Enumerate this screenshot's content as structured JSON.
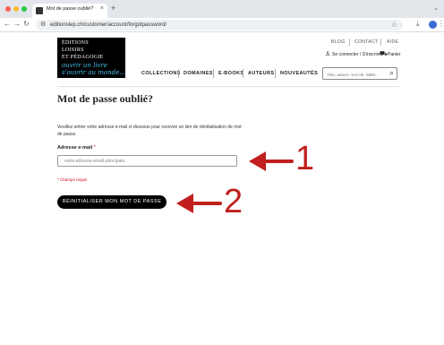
{
  "browser": {
    "tab_title": "Mot de passe oublié?",
    "url": "editionslep.ch/customer/account/forgotpassword/",
    "icons": [
      "back-icon",
      "forward-icon",
      "reload-icon",
      "site-info-icon",
      "star-icon",
      "download-icon",
      "profile-icon",
      "menu-icon"
    ]
  },
  "brand": {
    "lines": [
      "ÉDITIONS",
      "LOISIRS",
      "ET PÉDAGOGIE"
    ],
    "slogan": [
      "ouvrir un livre",
      "s'ouvrir au monde..."
    ],
    "colors": {
      "logo_bg": "#000000",
      "slogan": "#48b8e6"
    }
  },
  "topnav": {
    "blog": "BLOG",
    "contact": "CONTACT",
    "aide": "AIDE"
  },
  "account": {
    "login": "Se connecter / S'inscrire",
    "cart": "Panier"
  },
  "mainnav": {
    "collections": "COLLECTIONS",
    "domaines": "DOMAINES",
    "ebooks": "E-BOOKS",
    "auteurs": "AUTEURS",
    "nouveautes": "NOUVEAUTÉS"
  },
  "search": {
    "placeholder": "Titre, auteur, mot-clé, ISBN..."
  },
  "form": {
    "title": "Mot de passe oublié?",
    "description": "Veuillez entrer votre adresse e-mail ci-dessous pour recevoir un lien de réinitialisation de mot de passe.",
    "email_label": "Adresse e-mail",
    "required_mark": "*",
    "email_placeholder": "votre-adresse-email-principale",
    "required_note": "* Champs requis",
    "submit": "RÉINITIALISER MON MOT DE PASSE"
  },
  "annotations": {
    "one": "1",
    "two": "2",
    "color": "#c0201e"
  }
}
